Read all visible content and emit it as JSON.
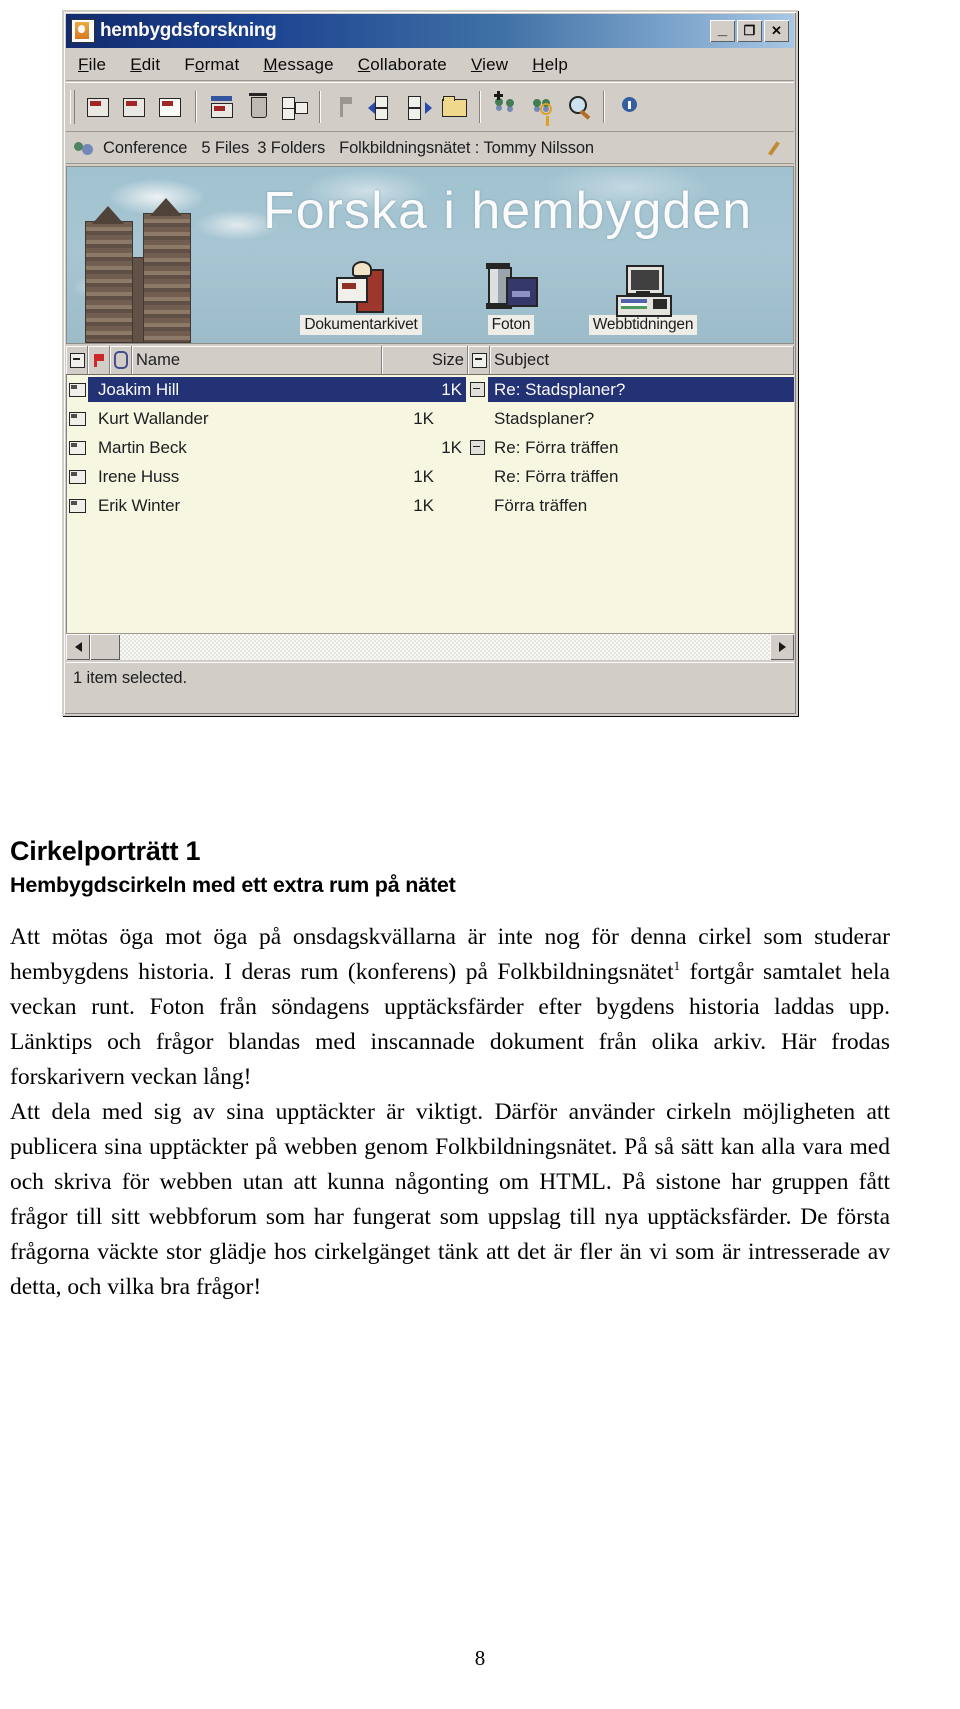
{
  "screenshot": {
    "window": {
      "title": "hembygdsforskning",
      "app_icon": "app-icon",
      "controls": {
        "minimize": "_",
        "maximize": "❐",
        "close": "✕"
      }
    },
    "menus": [
      {
        "label": "File",
        "accel": "F"
      },
      {
        "label": "Edit",
        "accel": "E"
      },
      {
        "label": "Format",
        "accel": "o"
      },
      {
        "label": "Message",
        "accel": "M"
      },
      {
        "label": "Collaborate",
        "accel": "C"
      },
      {
        "label": "View",
        "accel": "V"
      },
      {
        "label": "Help",
        "accel": "H"
      }
    ],
    "toolbar": {
      "groups": [
        [
          "new-message-icon",
          "reply-icon",
          "forward-icon"
        ],
        [
          "save-message-icon",
          "delete-icon",
          "properties-icon"
        ],
        [
          "flag-icon",
          "previous-message-icon",
          "next-message-icon",
          "move-to-folder-icon"
        ],
        [
          "add-members-icon",
          "conference-key-icon",
          "find-icon"
        ]
      ]
    },
    "conference_bar": {
      "icon": "conference-icon",
      "type_label": "Conference",
      "files_label": "5 Files",
      "folders_label": "3 Folders",
      "location_label": "Folkbildningsnätet : Tommy Nilsson",
      "edit_icon": "pencil-icon"
    },
    "banner": {
      "title": "Forska i hembygden",
      "shortcuts": [
        {
          "label": "Dokumentarkivet",
          "icon": "archive-icon"
        },
        {
          "label": "Foton",
          "icon": "film-roll-icon"
        },
        {
          "label": "Webbtidningen",
          "icon": "computer-icon"
        }
      ]
    },
    "message_list": {
      "columns": [
        {
          "key": "thread",
          "label": "",
          "icon": "thread-collapse-icon"
        },
        {
          "key": "flag",
          "label": "",
          "icon": "flag-icon"
        },
        {
          "key": "attachment",
          "label": "",
          "icon": "paperclip-icon"
        },
        {
          "key": "name",
          "label": "Name"
        },
        {
          "key": "size",
          "label": "Size"
        },
        {
          "key": "threadsubject",
          "label": "",
          "icon": "thread-collapse-icon"
        },
        {
          "key": "subject",
          "label": "Subject"
        }
      ],
      "rows": [
        {
          "name": "Joakim Hill",
          "size": "1K",
          "subject": "Re: Stadsplaner?",
          "thread": true,
          "indent": false,
          "selected": true
        },
        {
          "name": "Kurt Wallander",
          "size": "1K",
          "subject": "Stadsplaner?",
          "thread": false,
          "indent": true,
          "selected": false
        },
        {
          "name": "Martin Beck",
          "size": "1K",
          "subject": "Re: Förra träffen",
          "thread": true,
          "indent": false,
          "selected": false
        },
        {
          "name": "Irene Huss",
          "size": "1K",
          "subject": "Re: Förra träffen",
          "thread": false,
          "indent": true,
          "selected": false
        },
        {
          "name": "Erik Winter",
          "size": "1K",
          "subject": "Förra träffen",
          "thread": false,
          "indent": true,
          "selected": false
        }
      ]
    },
    "status_bar": {
      "text": "1 item selected."
    }
  },
  "article": {
    "kicker": "Cirkelporträtt 1",
    "subtitle": "Hembygdscirkeln med ett extra rum på nätet",
    "paragraph1": "Att mötas öga mot öga på onsdagskvällarna är inte nog för denna cirkel som studerar hembygdens historia. I deras rum (konferens) på Folkbildningsnätet",
    "footnote_marker": "1",
    "paragraph1_cont": " fortgår samtalet hela veckan runt. Foton från söndagens upptäcksfärder efter bygdens historia laddas upp. Länktips och frågor blandas med inscannade dokument från olika arkiv. Här frodas forskarivern veckan lång!",
    "paragraph2": "Att dela med sig av sina upptäckter är viktigt. Därför använder cirkeln möjligheten att publicera sina upptäckter på webben genom Folkbildningsnätet. På så sätt kan alla vara med och skriva för webben utan att kunna någonting om HTML. På sistone har gruppen fått frågor till sitt webbforum som har fungerat som uppslag till nya upptäcksfärder. De första frågorna väckte stor glädje hos cirkelgänget tänk att det är fler än vi som är intresserade av detta, och vilka bra frågor!",
    "page_number": "8"
  }
}
